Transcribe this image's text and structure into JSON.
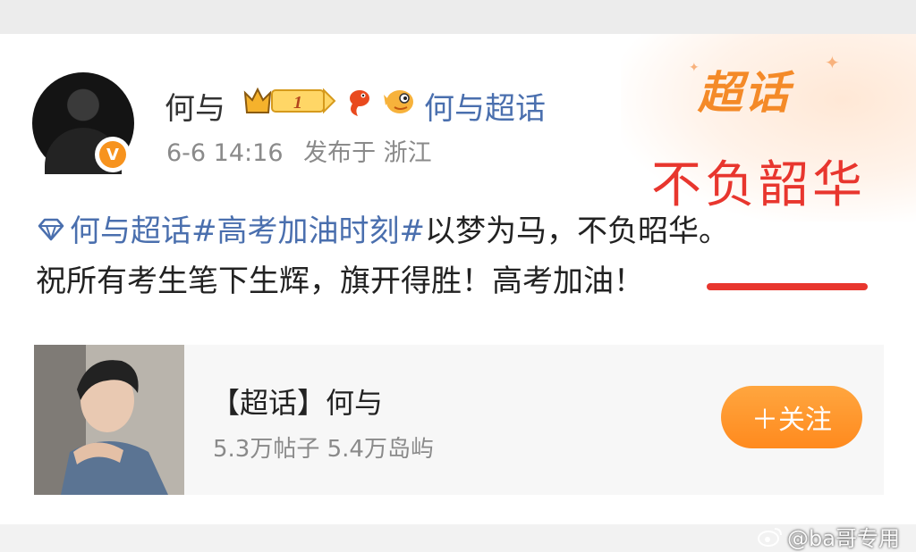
{
  "post": {
    "username": "何与",
    "rank": "1",
    "topic_link": "何与超话",
    "time": "6-6 14:16",
    "location": "发布于 浙江",
    "text": {
      "tag1": "何与超话",
      "tag2": "#高考加油时刻#",
      "line1_rest": "以梦为马，不负昭华。",
      "line2": "祝所有考生笔下生辉，旗开得胜！高考加油！"
    }
  },
  "overlay": {
    "logo": "超话",
    "caption": "不负韶华"
  },
  "topic_card": {
    "title": "【超话】何与",
    "stats": "5.3万帖子 5.4万岛屿",
    "follow_label": "＋关注"
  },
  "watermark": "@ba哥专用",
  "colors": {
    "accent_orange": "#ff8a1e",
    "link_blue": "#4a6fae",
    "highlight_red": "#e8362e"
  },
  "icons": {
    "verified": "verified-v-icon",
    "rank": "crown-rank-badge-icon",
    "fish": "goldfish-icon",
    "fan": "pufferfish-fan-icon",
    "diamond": "diamond-topic-icon",
    "weibo": "weibo-logo-icon"
  }
}
